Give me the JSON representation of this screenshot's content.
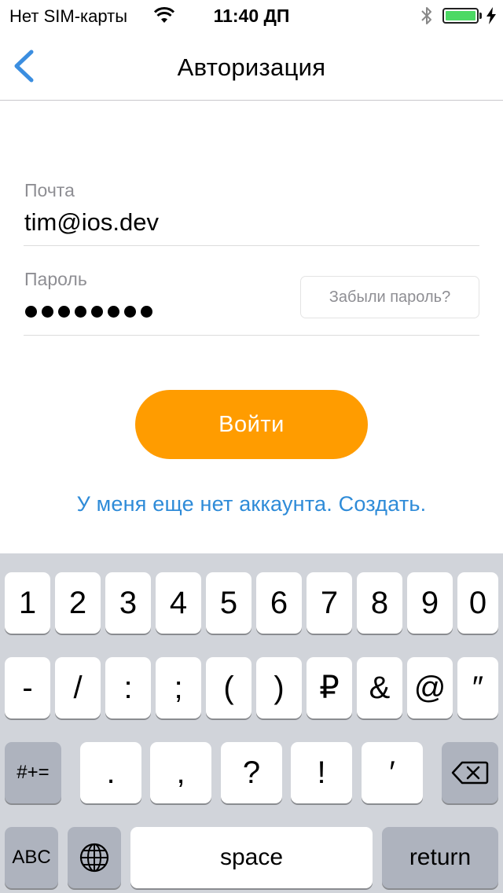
{
  "status_bar": {
    "carrier": "Нет SIM-карты",
    "time": "11:40 ДП",
    "battery_color": "#4cd964"
  },
  "nav": {
    "back_icon": "chevron-left-icon",
    "title": "Авторизация",
    "accent": "#3b8ee0"
  },
  "form": {
    "email_label": "Почта",
    "email_value": "tim@ios.dev",
    "password_label": "Пароль",
    "password_masked_length": 8,
    "forgot_label": "Забыли пароль?",
    "login_label": "Войти",
    "login_color": "#ff9c00",
    "create_account_link": "У меня еще нет аккаунта. Создать.",
    "link_color": "#2e8bd8"
  },
  "keyboard": {
    "row1": [
      "1",
      "2",
      "3",
      "4",
      "5",
      "6",
      "7",
      "8",
      "9",
      "0"
    ],
    "row2": [
      "-",
      "/",
      ":",
      ";",
      "(",
      ")",
      "₽",
      "&",
      "@",
      "″"
    ],
    "row3": [
      "#+=",
      ".",
      ",",
      "?",
      "!",
      "′"
    ],
    "delete_icon": "backspace-icon",
    "row4": {
      "abc": "ABC",
      "globe_icon": "globe-icon",
      "space": "space",
      "return": "return"
    }
  }
}
